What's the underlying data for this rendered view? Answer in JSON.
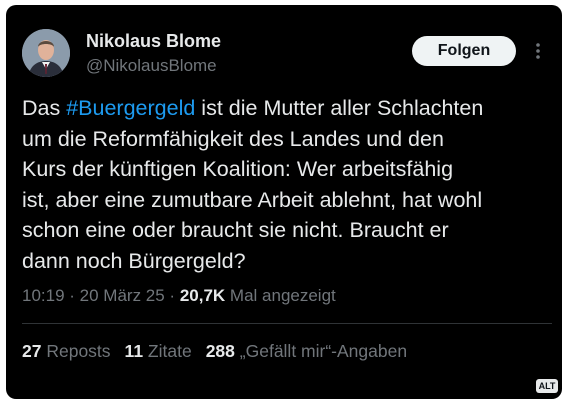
{
  "author": {
    "name": "Nikolaus Blome",
    "handle": "@NikolausBlome",
    "avatar_icon": "profile-photo"
  },
  "follow_button": {
    "label": "Folgen"
  },
  "more_icon": "more-vertical-icon",
  "tweet": {
    "lines": [
      {
        "pre": "Das ",
        "hashtag": "#Buergergeld",
        "post": " ist die Mutter aller Schlachten"
      },
      {
        "text": "um die Reformfähigkeit des Landes und den"
      },
      {
        "text": "Kurs der künftigen Koalition: Wer arbeitsfähig"
      },
      {
        "text": "ist, aber eine zumutbare Arbeit ablehnt, hat wohl"
      },
      {
        "text": "schon eine oder braucht sie nicht. Braucht er"
      },
      {
        "text": "dann noch Bürgergeld?"
      }
    ]
  },
  "meta": {
    "time": "10:19",
    "separator": " · ",
    "date": "20 März 25",
    "views_count": "20,7K",
    "views_label": "Mal angezeigt"
  },
  "stats": {
    "reposts_count": "27",
    "reposts_label": "Reposts",
    "quotes_count": "11",
    "quotes_label": "Zitate",
    "likes_count": "288",
    "likes_label": "„Gefällt mir“-Angaben"
  },
  "alt_badge": "ALT",
  "colors": {
    "background": "#000000",
    "text": "#e7e9ea",
    "secondary": "#71767b",
    "link": "#1d9bf0",
    "button_bg": "#eff3f4"
  }
}
